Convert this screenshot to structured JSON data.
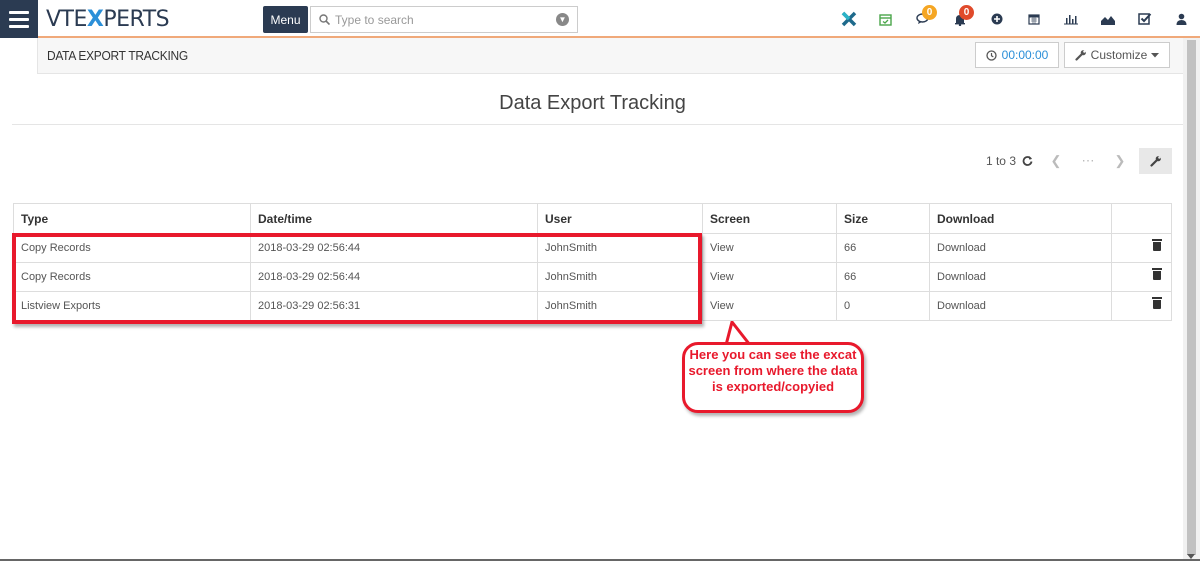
{
  "header": {
    "logo_prefix": "VTE",
    "logo_x": "X",
    "logo_suffix": "PERTS",
    "menu_label": "Menu",
    "search_placeholder": "Type to search",
    "comments_badge": "0",
    "notifications_badge": "0"
  },
  "subheader": {
    "module_title": "DATA EXPORT TRACKING",
    "timer": "00:00:00",
    "customize_label": "Customize"
  },
  "page": {
    "title": "Data Export Tracking"
  },
  "pager": {
    "range": "1 to 3"
  },
  "table": {
    "headers": [
      "Type",
      "Date/time",
      "User",
      "Screen",
      "Size",
      "Download"
    ],
    "rows": [
      {
        "type": "Copy Records",
        "datetime": "2018-03-29 02:56:44",
        "user": "JohnSmith",
        "screen": "View",
        "size": "66",
        "download": "Download"
      },
      {
        "type": "Copy Records",
        "datetime": "2018-03-29 02:56:44",
        "user": "JohnSmith",
        "screen": "View",
        "size": "66",
        "download": "Download"
      },
      {
        "type": "Listview Exports",
        "datetime": "2018-03-29 02:56:31",
        "user": "JohnSmith",
        "screen": "View",
        "size": "0",
        "download": "Download"
      }
    ]
  },
  "annotation": {
    "callout_text": "Here you can see the excat screen from where the data is exported/copyied"
  },
  "colors": {
    "navy": "#2b3b52",
    "accent_blue": "#2b8fd8",
    "annotation_red": "#e8192c",
    "badge_orange": "#f5a623",
    "badge_red": "#e04a2b"
  }
}
